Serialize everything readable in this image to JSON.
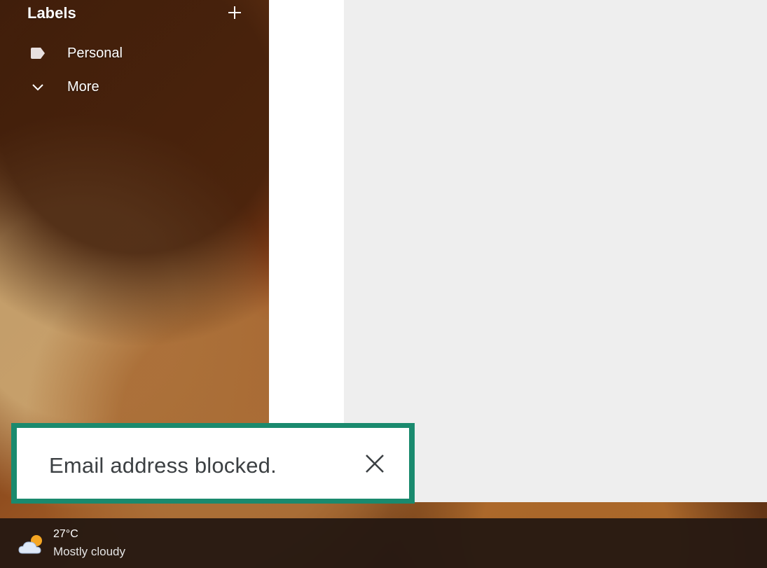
{
  "sidebar": {
    "labels_title": "Labels",
    "add_label_icon": "plus-icon",
    "items": [
      {
        "label": "Personal",
        "icon": "label-tag-icon"
      },
      {
        "label": "More",
        "icon": "chevron-down-icon"
      }
    ]
  },
  "snackbar": {
    "message": "Email address blocked.",
    "close_icon": "close-icon",
    "highlight_color": "#1a8a6e"
  },
  "taskbar": {
    "weather": {
      "temperature": "27°C",
      "condition": "Mostly cloudy",
      "icon": "partly-cloudy-icon"
    }
  },
  "colors": {
    "reading_pane": "#eeeeee",
    "list_panel": "#ffffff",
    "taskbar": "#261912"
  }
}
